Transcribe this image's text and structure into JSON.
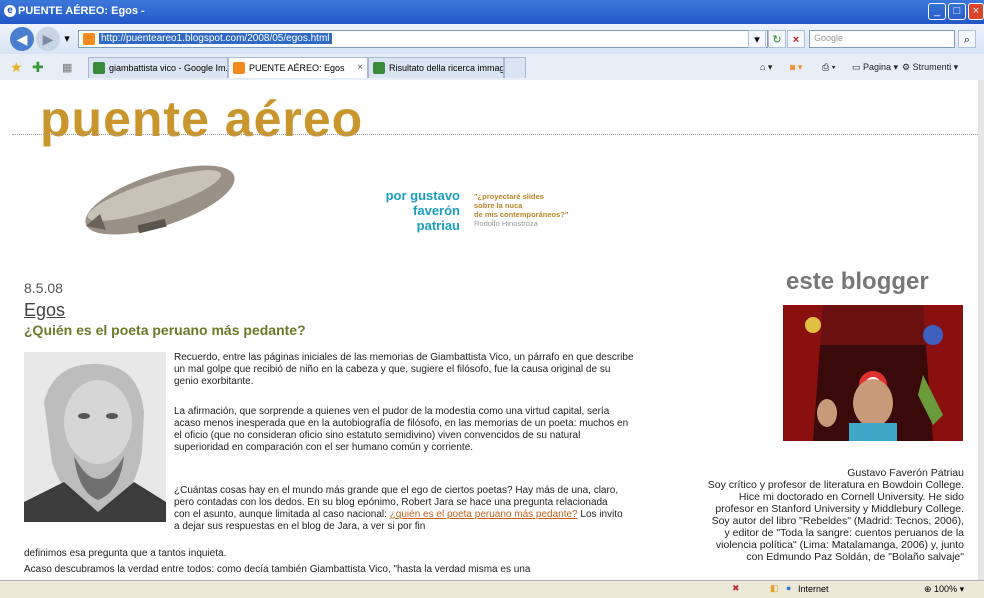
{
  "window": {
    "title": "PUENTE AÉREO: Egos -"
  },
  "address_bar": {
    "url": "http://puenteareo1.blogspot.com/2008/05/egos.html",
    "search_placeholder": "Google"
  },
  "tabs": [
    {
      "label": "giambattista vico - Google Im...",
      "active": false,
      "icon_color": "#3a8a3a"
    },
    {
      "label": "PUENTE AÉREO: Egos",
      "active": true,
      "icon_color": "#f28a1e"
    },
    {
      "label": "Risultato della ricerca immagi...",
      "active": false,
      "icon_color": "#3a8a3a"
    }
  ],
  "commands": {
    "page": "Pagina",
    "tools": "Strumenti"
  },
  "blog": {
    "title": "puente aéreo",
    "byline": {
      "por": "por gustavo",
      "name1": "faverón",
      "name2": "patriau"
    },
    "quote": {
      "l1": "\"¿proyectaré slides",
      "l2": "sobre la nuca",
      "l3": "de mis contemporáneos?\"",
      "author": "Rodolfo Hinostroza"
    }
  },
  "post": {
    "date": "8.5.08",
    "title": "Egos",
    "subtitle": "¿Quién es el poeta peruano más pedante?",
    "p1": "Recuerdo, entre las páginas iniciales de las memorias de Giambattista Vico, un párrafo en que describe un mal golpe que recibió de niño en la cabeza y que, sugiere el filósofo, fue la causa original de su genio exorbitante.",
    "p2": "La afirmación, que sorprende a quienes ven el pudor de la modestia como una virtud capital, sería acaso menos inesperada que en la autobiografía de filósofo, en las memorias de un poeta: muchos en el oficio (que no consideran oficio sino estatuto semidivino) viven convencidos de su natural superioridad en comparación con el ser humano común y corriente.",
    "p3a": "¿Cuántas cosas hay en el mundo más grande que el ego de ciertos poetas? Hay más de una, claro, pero contadas con los dedos. En su blog epónimo, Robert Jara se hace una pregunta relacionada con el asunto, aunque limitada al caso nacional: ",
    "p3link": "¿quién es el poeta peruano más pedante?",
    "p3b": " Los invito a dejar sus respuestas en el blog de Jara, a ver si por fin",
    "p3c": "definimos esa pregunta que a tantos inquieta.",
    "p4": "Acaso descubramos la verdad entre todos: como decía también Giambattista Vico, \"hasta la verdad misma es una"
  },
  "sidebar": {
    "heading": "este blogger",
    "bio": [
      "Gustavo Faverón Patriau",
      "Soy crítico y profesor de literatura en Bowdoin College.",
      "Hice mi doctorado en Cornell University. He sido",
      "profesor en Stanford University y Middlebury College.",
      "Soy autor del libro \"Rebeldes\" (Madrid: Tecnos, 2006),",
      "y editor de \"Toda la sangre: cuentos peruanos de la",
      "violencia política\" (Lima: Matalamanga, 2006) y, junto",
      "con Edmundo Paz Soldán, de \"Bolaño salvaje\""
    ]
  },
  "status": {
    "zone": "Internet",
    "zoom": "100%"
  }
}
